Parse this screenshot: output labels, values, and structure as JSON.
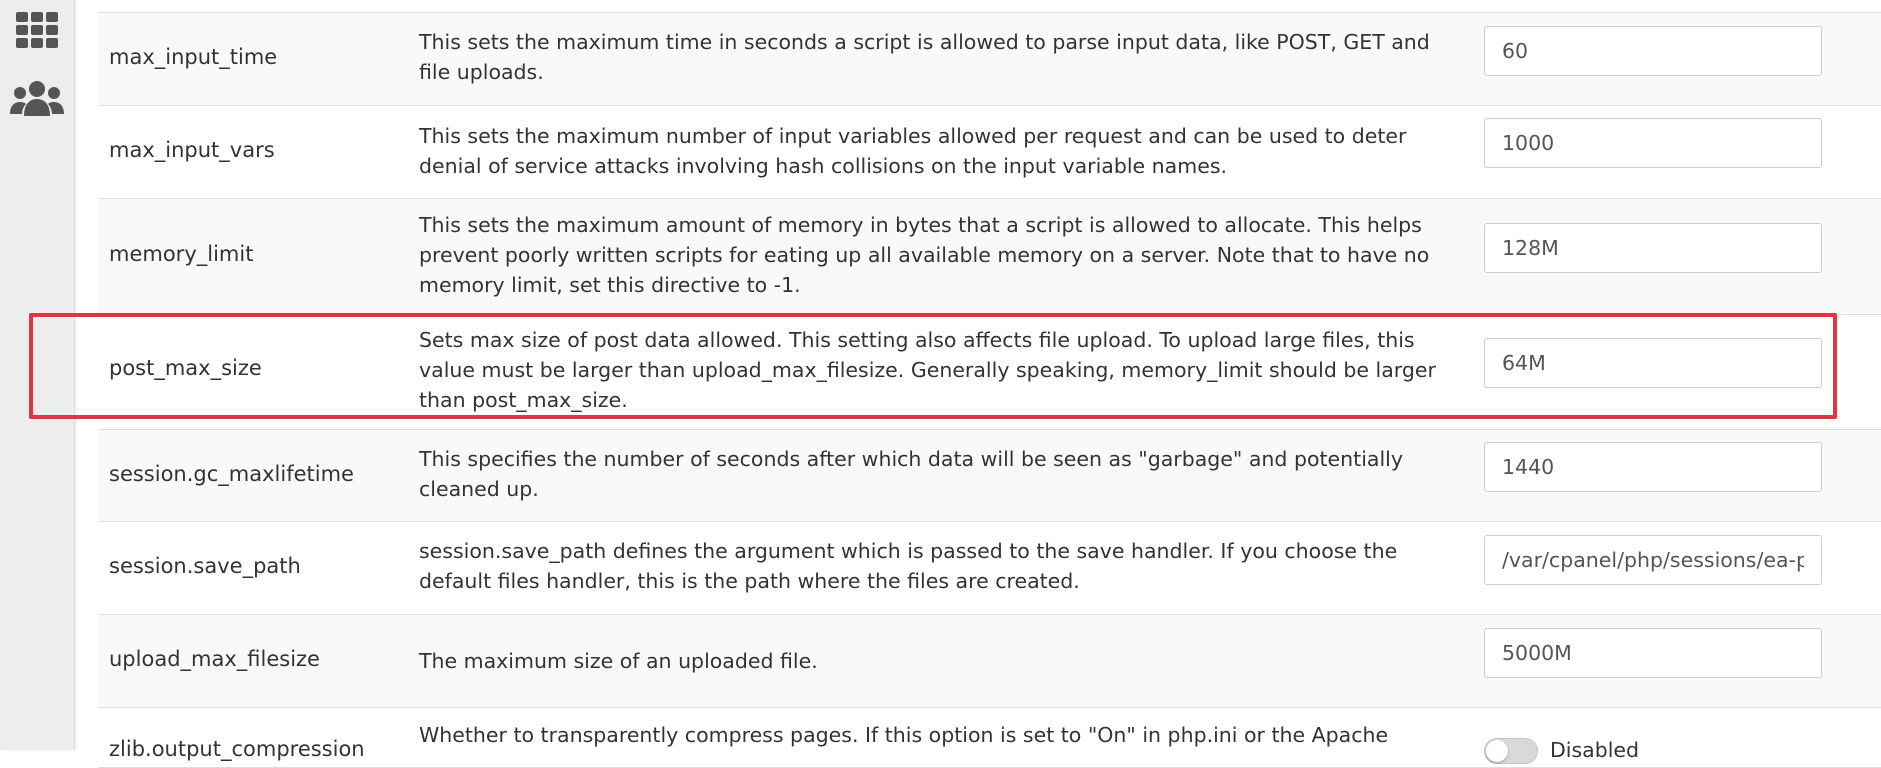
{
  "sidebar": {
    "items": [
      {
        "icon": "grid-icon"
      },
      {
        "icon": "users-icon"
      }
    ]
  },
  "rows": [
    {
      "name": "max_input_time",
      "description": "This sets the maximum time in seconds a script is allowed to parse input data, like POST, GET and file uploads.",
      "value": "60"
    },
    {
      "name": "max_input_vars",
      "description": "This sets the maximum number of input variables allowed per request and can be used to deter denial of service attacks involving hash collisions on the input variable names.",
      "value": "1000"
    },
    {
      "name": "memory_limit",
      "description": "This sets the maximum amount of memory in bytes that a script is allowed to allocate. This helps prevent poorly written scripts for eating up all available memory on a server. Note that to have no memory limit, set this directive to -1.",
      "value": "128M"
    },
    {
      "name": "post_max_size",
      "description": "Sets max size of post data allowed. This setting also affects file upload. To upload large files, this value must be larger than upload_max_filesize. Generally speaking, memory_limit should be larger than post_max_size.",
      "value": "64M"
    },
    {
      "name": "session.gc_maxlifetime",
      "description": "This specifies the number of seconds after which data will be seen as \"garbage\" and potentially cleaned up.",
      "value": "1440"
    },
    {
      "name": "session.save_path",
      "description": "session.save_path defines the argument which is passed to the save handler. If you choose the default files handler, this is the path where the files are created.",
      "value": "/var/cpanel/php/sessions/ea-p"
    },
    {
      "name": "upload_max_filesize",
      "description": "The maximum size of an uploaded file.",
      "value": "5000M"
    },
    {
      "name": "zlib.output_compression",
      "description": "Whether to transparently compress pages. If this option is set to \"On\" in php.ini or the Apache",
      "toggle_label": "Disabled"
    }
  ],
  "colors": {
    "highlight": "#e0363f",
    "row_stripe": "#f9f9f9",
    "border": "#dddddd"
  }
}
